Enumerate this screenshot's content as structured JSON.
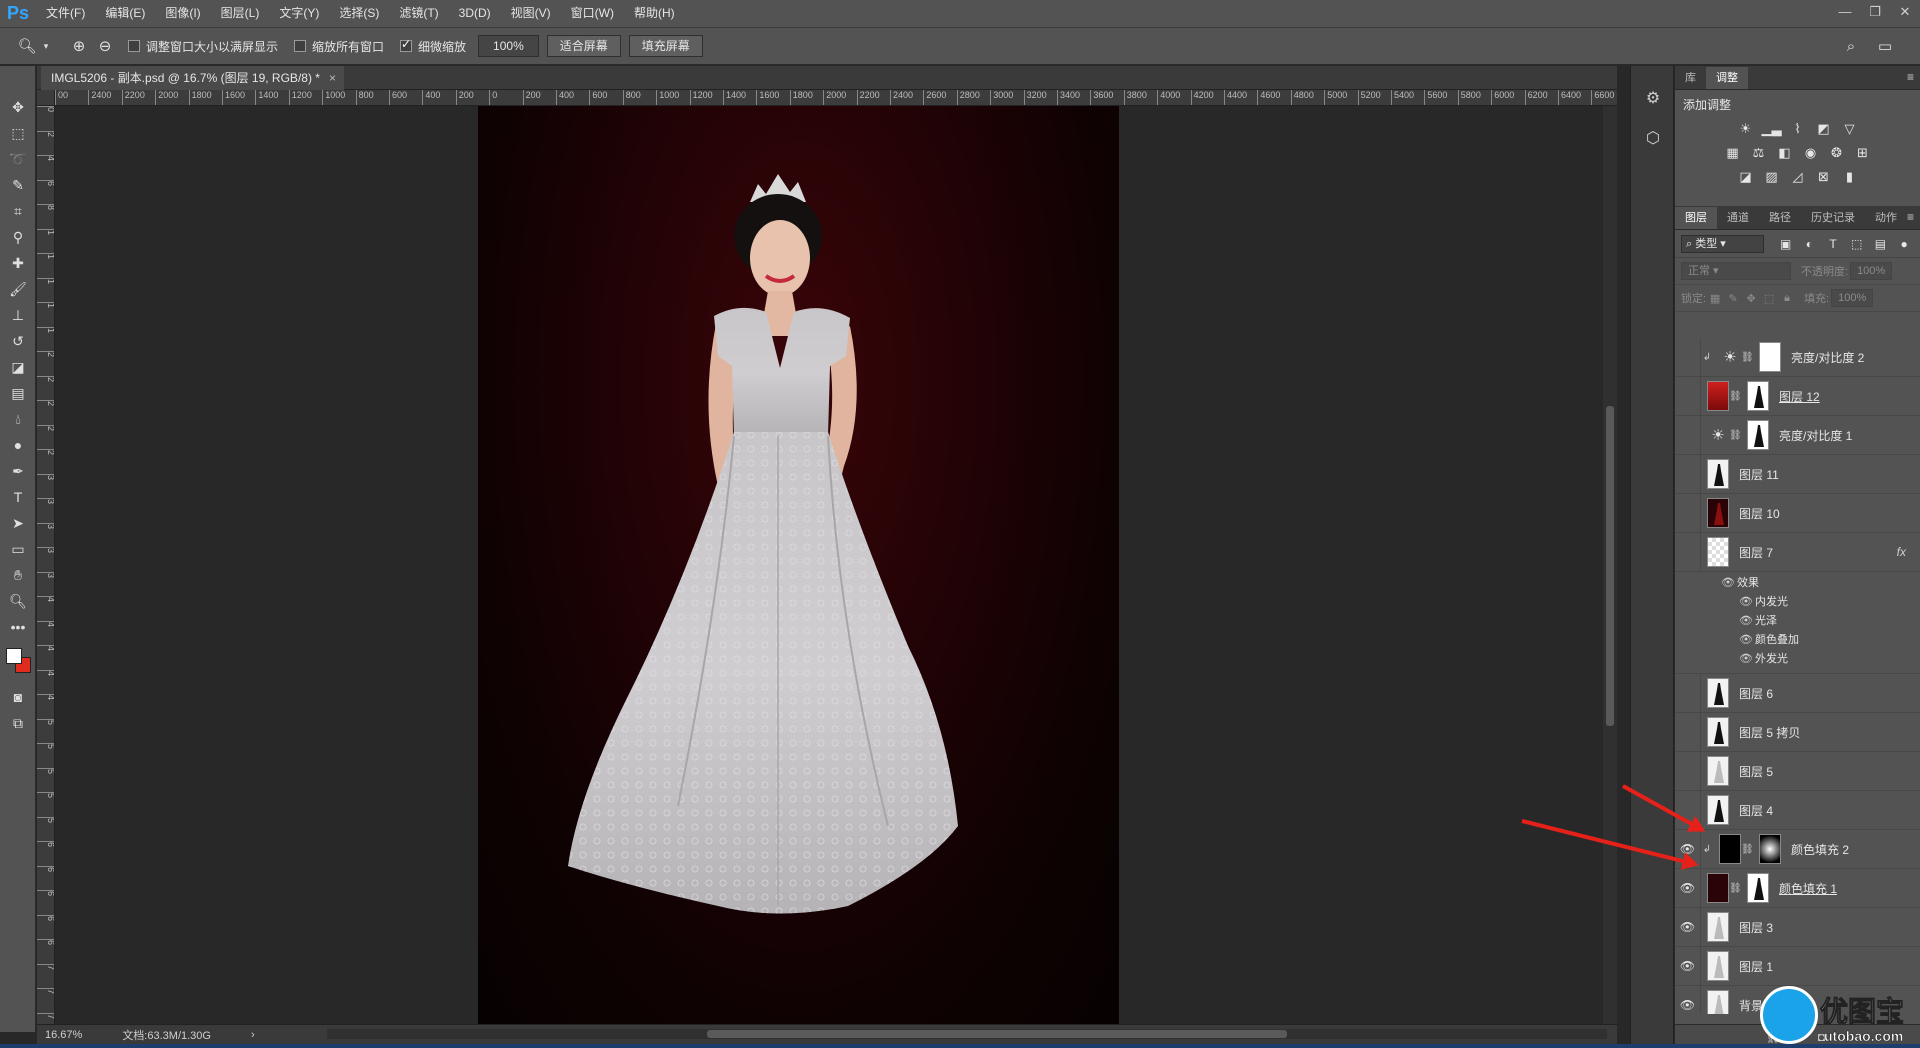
{
  "app": {
    "logo": "Ps"
  },
  "menu": [
    "文件(F)",
    "编辑(E)",
    "图像(I)",
    "图层(L)",
    "文字(Y)",
    "选择(S)",
    "滤镜(T)",
    "3D(D)",
    "视图(V)",
    "窗口(W)",
    "帮助(H)"
  ],
  "window_controls": {
    "minimize": "—",
    "restore": "❐",
    "close": "✕"
  },
  "options": {
    "resize_windows": {
      "label": "调整窗口大小以满屏显示",
      "checked": false
    },
    "zoom_all": {
      "label": "缩放所有窗口",
      "checked": false
    },
    "scrubby_zoom": {
      "label": "细微缩放",
      "checked": true
    },
    "zoom_value": "100%",
    "fit_screen": "适合屏幕",
    "fill_screen": "填充屏幕"
  },
  "document": {
    "tab_title": "IMGL5206 - 副本.psd @ 16.7% (图层 19, RGB/8) *",
    "close": "×",
    "zoom": "16.67%",
    "doc_size": "文档:63.3M/1.30G",
    "hruler_labels": [
      "00",
      "2400",
      "2200",
      "2000",
      "1800",
      "1600",
      "1400",
      "1200",
      "1000",
      "800",
      "600",
      "400",
      "200",
      "0",
      "200",
      "400",
      "600",
      "800",
      "1000",
      "1200",
      "1400",
      "1600",
      "1800",
      "2000",
      "2200",
      "2400",
      "2600",
      "2800",
      "3000",
      "3200",
      "3400",
      "3600",
      "3800",
      "4000",
      "4200",
      "4400",
      "4600",
      "4800",
      "5000",
      "5200",
      "5400",
      "5600",
      "5800",
      "6000",
      "6200",
      "6400",
      "6600"
    ],
    "vruler_labels": [
      "0",
      "2",
      "4",
      "6",
      "8",
      "1",
      "1",
      "1",
      "1",
      "1",
      "2",
      "2",
      "2",
      "2",
      "2",
      "3",
      "3",
      "3",
      "3",
      "3",
      "4",
      "4",
      "4",
      "4",
      "4",
      "5",
      "5",
      "5",
      "5",
      "5",
      "6",
      "6",
      "6",
      "6",
      "6",
      "7",
      "7",
      "7"
    ]
  },
  "panels": {
    "top_tabs": [
      {
        "label": "库",
        "active": false
      },
      {
        "label": "调整",
        "active": true
      }
    ],
    "adjust_title": "添加调整",
    "layer_tabs": [
      {
        "label": "图层",
        "active": true
      },
      {
        "label": "通道",
        "active": false
      },
      {
        "label": "路径",
        "active": false
      },
      {
        "label": "历史记录",
        "active": false
      },
      {
        "label": "动作",
        "active": false
      }
    ],
    "filter_label": "类型",
    "blend_mode": "正常",
    "opacity_label": "不透明度:",
    "opacity_value": "100%",
    "lock_label": "锁定:",
    "fill_label": "填充:",
    "fill_value": "100%",
    "menu_glyph": "≡"
  },
  "layers": [
    {
      "name": "亮度/对比度 2",
      "visible": false,
      "kind": "adjust",
      "clip": true,
      "mask": "white"
    },
    {
      "name": "图层 12",
      "visible": false,
      "kind": "fire",
      "mask": "figure",
      "underline": true
    },
    {
      "name": "亮度/对比度 1",
      "visible": false,
      "kind": "adjust",
      "mask": "figure"
    },
    {
      "name": "图层 11",
      "visible": false,
      "kind": "figure-white"
    },
    {
      "name": "图层 10",
      "visible": false,
      "kind": "figure-dark"
    },
    {
      "name": "图层 7",
      "visible": false,
      "kind": "check",
      "fx": "fx",
      "effects_label": "效果",
      "effects": [
        "内发光",
        "光泽",
        "颜色叠加",
        "外发光"
      ]
    },
    {
      "name": "图层 6",
      "visible": false,
      "kind": "figure-white"
    },
    {
      "name": "图层 5 拷贝",
      "visible": false,
      "kind": "figure-white"
    },
    {
      "name": "图层 5",
      "visible": false,
      "kind": "figure-light"
    },
    {
      "name": "图层 4",
      "visible": false,
      "kind": "figure-white"
    },
    {
      "name": "颜色填充 2",
      "visible": true,
      "kind": "black",
      "clip": true,
      "mask": "gradient"
    },
    {
      "name": "颜色填充 1",
      "visible": true,
      "kind": "dark",
      "mask": "figure",
      "underline": true
    },
    {
      "name": "图层 3",
      "visible": true,
      "kind": "figure-light"
    },
    {
      "name": "图层 1",
      "visible": true,
      "kind": "figure-light"
    },
    {
      "name": "背景",
      "visible": true,
      "kind": "figure-light"
    }
  ],
  "watermark": {
    "name": "优图宝",
    "url": "utobao.com"
  }
}
